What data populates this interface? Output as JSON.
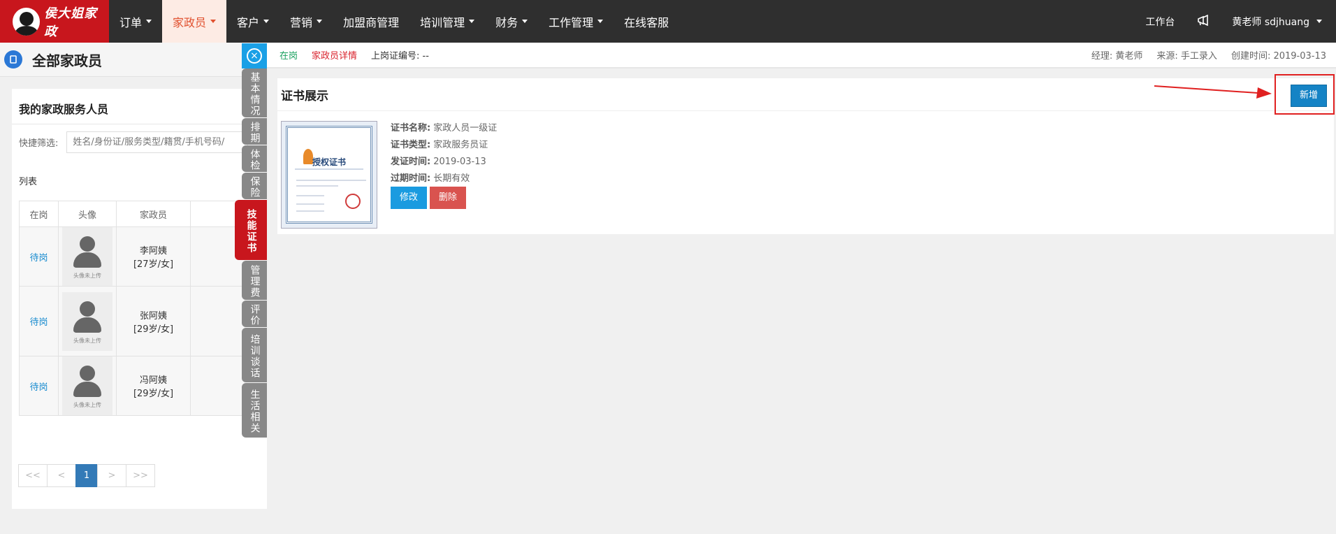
{
  "nav": {
    "logo_text": "侯大姐家政",
    "items": [
      {
        "label": "订单",
        "dropdown": true
      },
      {
        "label": "家政员",
        "dropdown": true,
        "active": true
      },
      {
        "label": "客户",
        "dropdown": true
      },
      {
        "label": "营销",
        "dropdown": true
      },
      {
        "label": "加盟商管理",
        "dropdown": false
      },
      {
        "label": "培训管理",
        "dropdown": true
      },
      {
        "label": "财务",
        "dropdown": true
      },
      {
        "label": "工作管理",
        "dropdown": true
      },
      {
        "label": "在线客服",
        "dropdown": false
      }
    ],
    "workbench": "工作台",
    "user": "黄老师  sdjhuang",
    "accent": "#c8161d"
  },
  "left": {
    "page_title": "全部家政员",
    "section_title": "我的家政服务人员",
    "filter_label": "快捷筛选:",
    "filter_placeholder": "姓名/身份证/服务类型/籍贯/手机号码/",
    "list_title": "列表",
    "columns": [
      "在岗",
      "头像",
      "家政员"
    ],
    "rows": [
      {
        "status": "待岗",
        "avatar_text": "头像未上传",
        "name": "李阿姨",
        "info": "[27岁/女]"
      },
      {
        "status": "待岗",
        "avatar_text": "头像未上传",
        "name": "张阿姨",
        "info": "[29岁/女]"
      },
      {
        "status": "待岗",
        "avatar_text": "头像未上传",
        "name": "冯阿姨",
        "info": "[29岁/女]"
      }
    ],
    "pager": [
      "<<",
      "<",
      "1",
      ">",
      ">>"
    ]
  },
  "tabs": [
    {
      "label": "基本情况"
    },
    {
      "label": "排期"
    },
    {
      "label": "体检"
    },
    {
      "label": "保险"
    },
    {
      "label": "技能证书",
      "active": true
    },
    {
      "label": "管理费"
    },
    {
      "label": "评价"
    },
    {
      "label": "培训谈话"
    },
    {
      "label": "生活相关"
    }
  ],
  "detail": {
    "status": "在岗",
    "detail_link": "家政员详情",
    "cert_no": "上岗证编号: --",
    "manager": "经理: 黄老师",
    "source": "来源: 手工录入",
    "created": "创建时间: 2019-03-13",
    "section_title": "证书展示",
    "add_label": "新增",
    "cert": {
      "image_title": "授权证书",
      "name_key": "证书名称:",
      "name": "家政人员一级证",
      "type_key": "证书类型:",
      "type": "家政服务员证",
      "issue_key": "发证时间:",
      "issue": "2019-03-13",
      "expire_key": "过期时间:",
      "expire": "长期有效",
      "edit_label": "修改",
      "delete_label": "删除"
    }
  }
}
